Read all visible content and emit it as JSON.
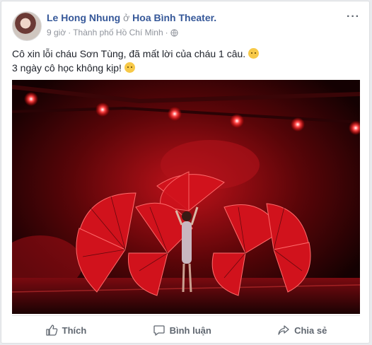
{
  "post": {
    "author": "Le Hong Nhung",
    "at_word": "ở",
    "place": "Hoa Bình Theater.",
    "time": "9 giờ",
    "separator": "·",
    "location": "Thành phố Hồ Chí Minh",
    "separator2": "·",
    "privacy_icon": "globe-icon",
    "more_label": "···",
    "line1": "Cô xin lỗi cháu Sơn Tùng, đã mất lời của cháu 1 câu.",
    "line1_emoji": "sad-face-emoji",
    "line2": "3 ngày cô học không kịp!",
    "line2_emoji": "worried-face-emoji"
  },
  "photo": {
    "subject": "stage-performance-red-fans"
  },
  "actions": {
    "like_label": "Thích",
    "comment_label": "Bình luận",
    "share_label": "Chia sẻ"
  },
  "colors": {
    "link": "#365899",
    "meta": "#90949c",
    "action": "#606770",
    "stage_red": "#d1121c"
  }
}
